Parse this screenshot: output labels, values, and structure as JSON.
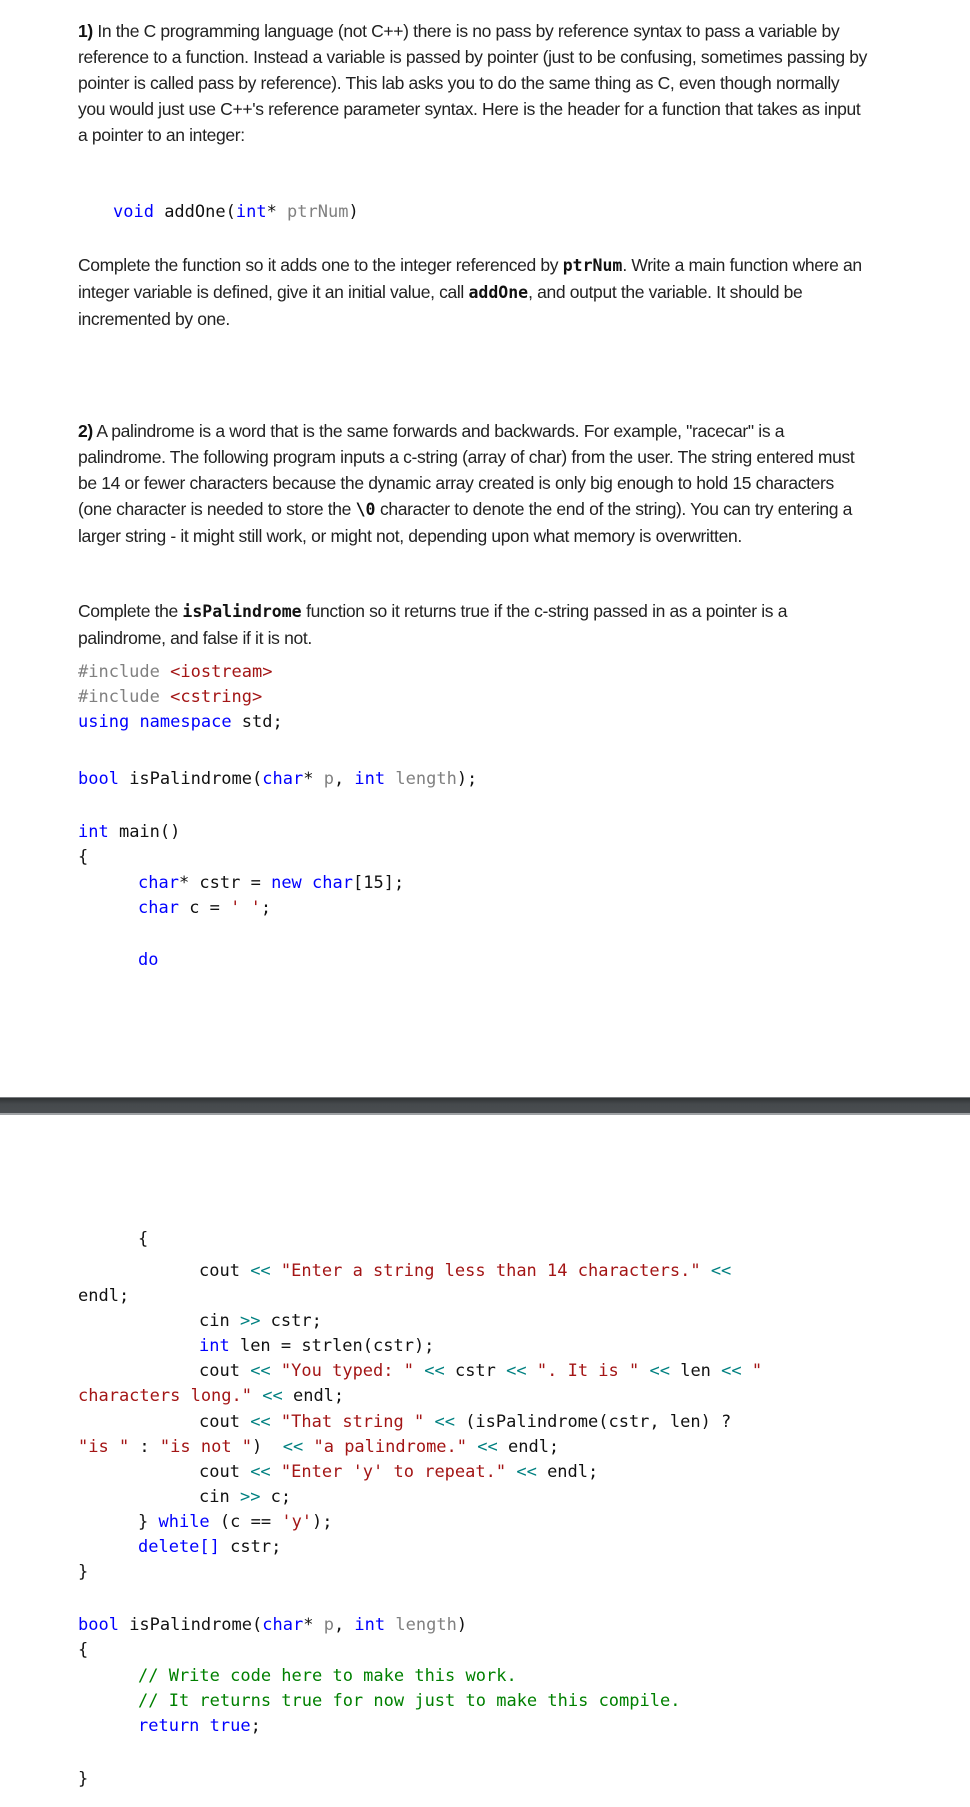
{
  "section1": {
    "number": "1)",
    "intro": " In the C programming language (not C++) there is no pass by reference syntax to pass a variable by reference to a function. Instead a variable is passed by pointer (just to be confusing, sometimes passing by pointer is called pass by reference). This lab asks you to do the same thing as C, even though normally you would just use C++'s reference parameter syntax. Here is the header for a function that takes as input a pointer to an integer:",
    "header_code": {
      "kw_void": "void",
      "name": " addOne(",
      "kw_int": "int",
      "star": "* ",
      "param": "ptrNum",
      "close": ")"
    },
    "task_parts": [
      "Complete the function so it adds one to the integer referenced by ",
      "ptrNum",
      ". Write a main function where an integer variable is defined, give it an initial value, call ",
      "addOne",
      ", and output the variable. It should be incremented by one."
    ]
  },
  "section2": {
    "number": "2)",
    "intro": " A palindrome is a word that is the same forwards and backwards. For example, \"racecar\" is a palindrome. The following program inputs a c-string (array of char) from the user. The string entered must be 14 or fewer characters because the dynamic array created is only big enough to hold 15 characters (one character is needed to store the ",
    "null_char": "\\0",
    "intro_end": " character to denote the end of the string). You can try entering a larger string - it might still work, or might not, depending upon what memory is overwritten.",
    "task_parts": [
      "Complete the ",
      "isPalindrome",
      " function so it returns true if the c-string passed in as a pointer is a palindrome, and false if it is not."
    ]
  },
  "code": {
    "include1": [
      "#include ",
      "<iostream>"
    ],
    "include2": [
      "#include ",
      "<cstring>"
    ],
    "using": [
      "using",
      " ",
      "namespace",
      " std;"
    ],
    "decl": [
      "bool",
      " isPalindrome(",
      "char",
      "* ",
      "p",
      ", ",
      "int",
      " ",
      "length",
      ");"
    ],
    "main_sig": [
      "int",
      " main()"
    ],
    "open_brace": "{",
    "cstr_decl": [
      "char",
      "* cstr = ",
      "new",
      " ",
      "char",
      "[15];"
    ],
    "c_decl": [
      "char",
      " c = ",
      "' '",
      ";"
    ],
    "do_kw": "do",
    "loop_open": "{",
    "cout1": [
      "cout ",
      "<<",
      " ",
      "\"Enter a string less than 14 characters.\"",
      " ",
      "<<"
    ],
    "cout1_wrap": "endl;",
    "cin1": [
      "cin ",
      ">>",
      " cstr;"
    ],
    "len_decl": [
      "int",
      " len = strlen(cstr);"
    ],
    "cout2": [
      "cout ",
      "<<",
      " ",
      "\"You typed: \"",
      " ",
      "<<",
      " cstr ",
      "<<",
      " ",
      "\". It is \"",
      " ",
      "<<",
      " len ",
      "<<",
      " ",
      "\""
    ],
    "cout2_wrap": [
      "characters long.\"",
      " ",
      "<<",
      " endl;"
    ],
    "cout3": [
      "cout ",
      "<<",
      " ",
      "\"That string \"",
      " ",
      "<<",
      " (isPalindrome(cstr, len) ?"
    ],
    "cout3_wrap": [
      "\"is \"",
      " : ",
      "\"is not \"",
      ")  ",
      "<<",
      " ",
      "\"a palindrome.\"",
      " ",
      "<<",
      " endl;"
    ],
    "cout4": [
      "cout ",
      "<<",
      " ",
      "\"Enter 'y' to repeat.\"",
      " ",
      "<<",
      " endl;"
    ],
    "cin2": [
      "cin ",
      ">>",
      " c;"
    ],
    "while_line": [
      "} ",
      "while",
      " (c == ",
      "'y'",
      ");"
    ],
    "delete_line": [
      "delete[]",
      " cstr;"
    ],
    "close_brace": "}",
    "def_sig": [
      "bool",
      " isPalindrome(",
      "char",
      "* ",
      "p",
      ", ",
      "int",
      " ",
      "length",
      ")"
    ],
    "def_open": "{",
    "comment1": "// Write code here to make this work.",
    "comment2": "// It returns true for now just to make this compile.",
    "return_line": [
      "return",
      " ",
      "true",
      ";"
    ],
    "def_close": "}"
  },
  "colors": {
    "keyword": "#0000ff",
    "string": "#a31515",
    "preprocessor": "#808080",
    "parameter": "#808080",
    "operator": "#008080",
    "comment": "#008000",
    "divider": "#45494c"
  }
}
